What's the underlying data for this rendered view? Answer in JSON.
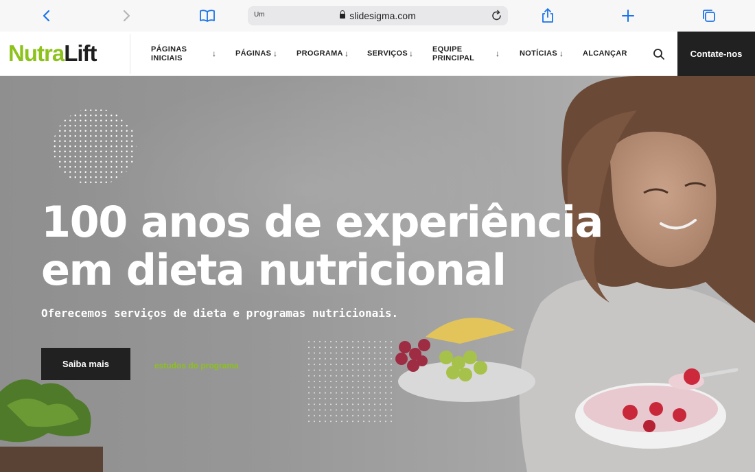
{
  "browser": {
    "url_label": "Um",
    "domain": "slidesigma.com"
  },
  "header": {
    "logo_part1": "Nutra",
    "logo_part2": "Lift",
    "nav": [
      {
        "label": "PÁGINAS INICIAIS",
        "dropdown": true
      },
      {
        "label": "PÁGINAS",
        "dropdown": true
      },
      {
        "label": "PROGRAMA",
        "dropdown": true
      },
      {
        "label": "SERVIÇOS",
        "dropdown": true
      },
      {
        "label": "EQUIPE PRINCIPAL",
        "dropdown": true
      },
      {
        "label": "NOTÍCIAS",
        "dropdown": true
      },
      {
        "label": "ALCANÇAR",
        "dropdown": false
      }
    ],
    "search_icon": "search-icon",
    "contact_label": "Contate-nos"
  },
  "hero": {
    "title": "100 anos de experiência em dieta nutricional",
    "subtitle": "Oferecemos serviços de dieta e programas nutricionais.",
    "cta_label": "Saiba mais",
    "link_label": "estudos do programa"
  },
  "colors": {
    "brand_green": "#8cc21b",
    "dark": "#212121",
    "hero_overlay": "#9a9a9a"
  }
}
